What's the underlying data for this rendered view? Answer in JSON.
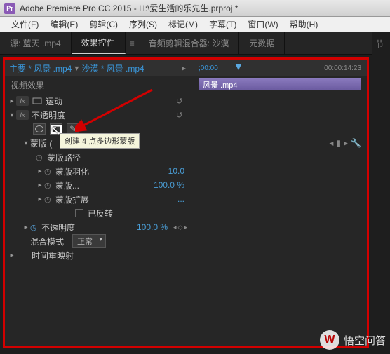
{
  "app": {
    "icon_text": "Pr",
    "title": "Adobe Premiere Pro CC 2015 - H:\\爱生活的乐先生.prproj *"
  },
  "menus": [
    "文件(F)",
    "编辑(E)",
    "剪辑(C)",
    "序列(S)",
    "标记(M)",
    "字幕(T)",
    "窗口(W)",
    "帮助(H)"
  ],
  "tabs": {
    "source": "源: 蓝天 .mp4",
    "effect": "效果控件",
    "audio": "音频剪辑混合器: 沙漠",
    "meta": "元数据"
  },
  "right_tab": "节",
  "clip": {
    "master": "主要 * 风景 .mp4",
    "seq": "沙漠 * 风景 .mp4",
    "bar_label": "风景 .mp4"
  },
  "section": {
    "video_fx": "视频效果",
    "motion": "运动",
    "opacity": "不透明度",
    "mask": "蒙版 (",
    "mask_path": "蒙版路径",
    "mask_feather": "蒙版羽化",
    "mask_opacity": "蒙版...",
    "mask_expansion": "蒙版扩展",
    "inverted": "已反转",
    "opacity_prop": "不透明度",
    "blend_mode": "混合模式",
    "time_remap": "时间重映射"
  },
  "values": {
    "feather": "10.0",
    "mask_opacity": "100.0 %",
    "expansion": "...",
    "opacity": "100.0 %",
    "blend": "正常"
  },
  "tooltip": "创建 4 点多边形蒙版",
  "timeline": {
    "start": ";00:00",
    "end": "00:00:14:23"
  },
  "watermark": "悟空问答",
  "icons": {
    "fx": "fx",
    "reset": "↺"
  }
}
